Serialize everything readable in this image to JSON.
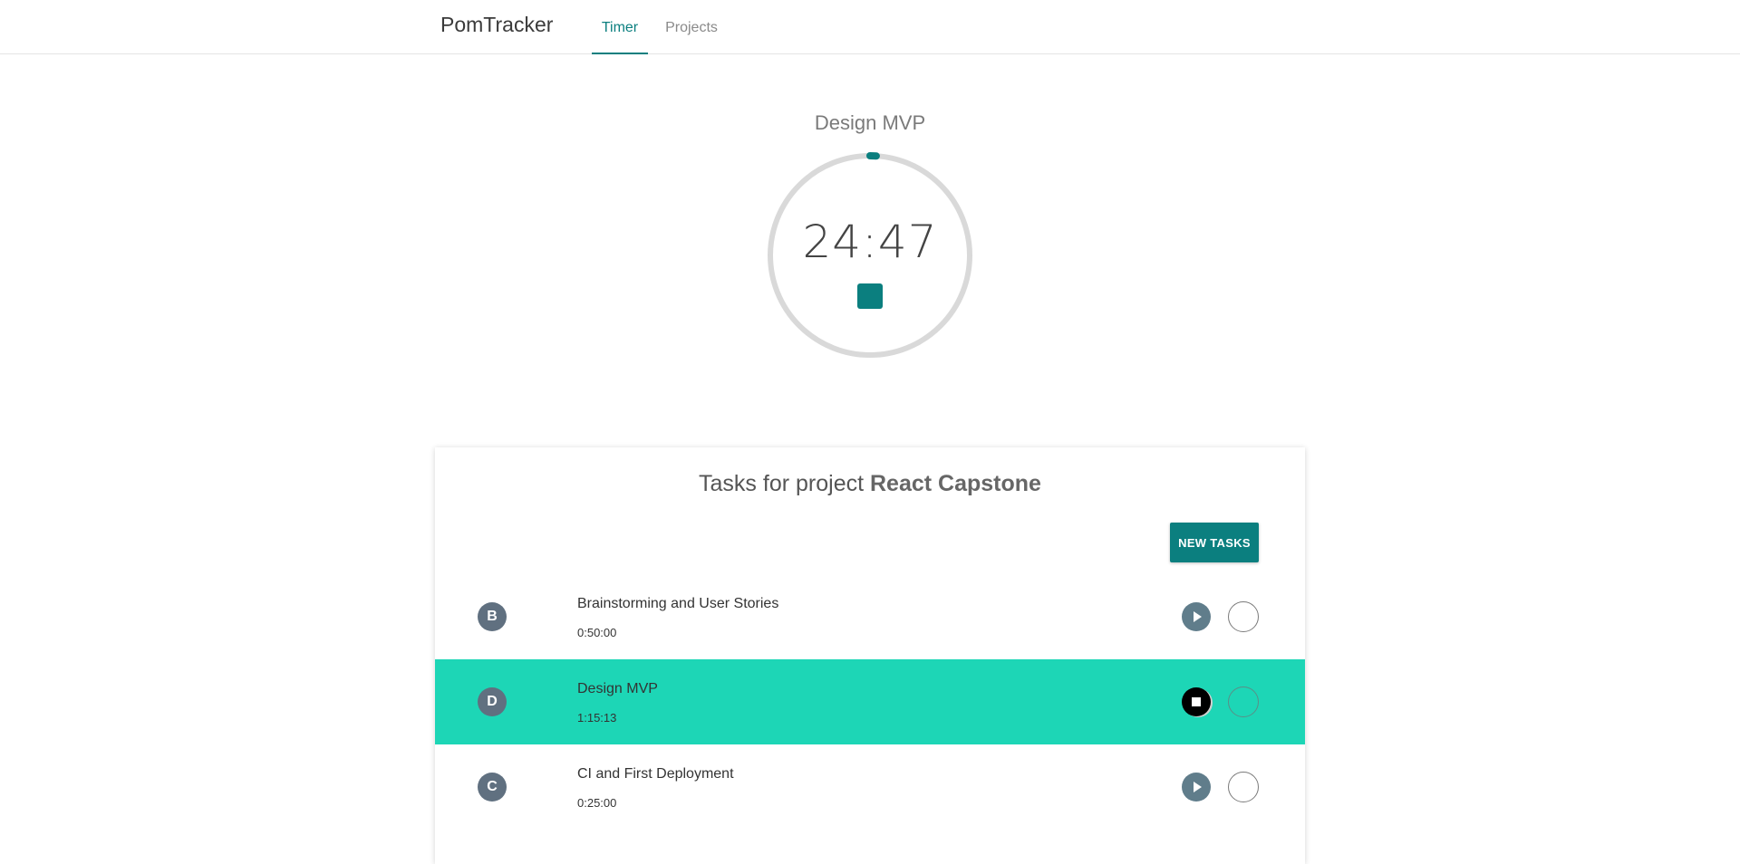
{
  "header": {
    "brand": "PomTracker",
    "tabs": [
      {
        "label": "Timer",
        "active": true
      },
      {
        "label": "Projects",
        "active": false
      }
    ]
  },
  "timer": {
    "task_title": "Design MVP",
    "time": "24:47",
    "progress_fraction": 0.01,
    "colors": {
      "accent": "#0b7f7f",
      "track": "#d9d9d9"
    }
  },
  "tasks_panel": {
    "title_prefix": "Tasks for project",
    "project_name": "React Capstone",
    "new_task_label": "NEW TASKS",
    "tasks": [
      {
        "initial": "B",
        "name": "Brainstorming and User Stories",
        "time": "0:50:00",
        "active": false,
        "action_icon": "play-icon"
      },
      {
        "initial": "D",
        "name": "Design MVP",
        "time": "1:15:13",
        "active": true,
        "action_icon": "stop-icon"
      },
      {
        "initial": "C",
        "name": "CI and First Deployment",
        "time": "0:25:00",
        "active": false,
        "action_icon": "play-icon"
      }
    ],
    "colors": {
      "active_row": "#1dd6b6",
      "avatar": "#607080",
      "button": "#0b7f7f"
    }
  }
}
